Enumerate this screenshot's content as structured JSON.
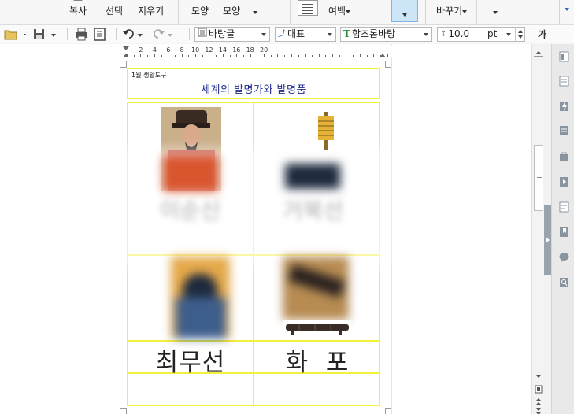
{
  "ribbon": {
    "items": [
      {
        "line1": "",
        "line2": "복사"
      },
      {
        "line1": "",
        "line2": "선택"
      },
      {
        "line1": "",
        "line2": "지우기"
      },
      {
        "line1": "",
        "line2": "모양"
      },
      {
        "line1": "",
        "line2": "모양"
      },
      {
        "line1": "",
        "line2": "여백"
      },
      {
        "line1": "",
        "line2": "바꾸기"
      }
    ]
  },
  "toolbar": {
    "style_combo": "바탕글",
    "lang_combo": "대표",
    "font_combo": "함초롬바탕",
    "font_size": "10.0",
    "size_unit": "pt",
    "style_button": "가"
  },
  "ruler": {
    "numbers": [
      "2",
      "4",
      "6",
      "8",
      "10",
      "12",
      "14",
      "16",
      "18",
      "20"
    ]
  },
  "document": {
    "header_small": "1월 생활도구",
    "header_title": "세계의 발명가와 발명품",
    "cells": {
      "top_left_name": "이순신",
      "top_right_name": "거북선",
      "bottom_left_name": "최무선",
      "bottom_right_name": "화  포"
    }
  },
  "colors": {
    "table_border": "#f3f03a",
    "title_text": "#1f2a8c",
    "active_ribbon": "#cde6f7"
  },
  "side_panel": {
    "icons": [
      "page-icon",
      "document-icon",
      "lightning-icon",
      "list-icon",
      "bag-icon",
      "play-icon",
      "text-box-icon",
      "bookmark-icon",
      "comment-icon",
      "search-doc-icon"
    ]
  }
}
